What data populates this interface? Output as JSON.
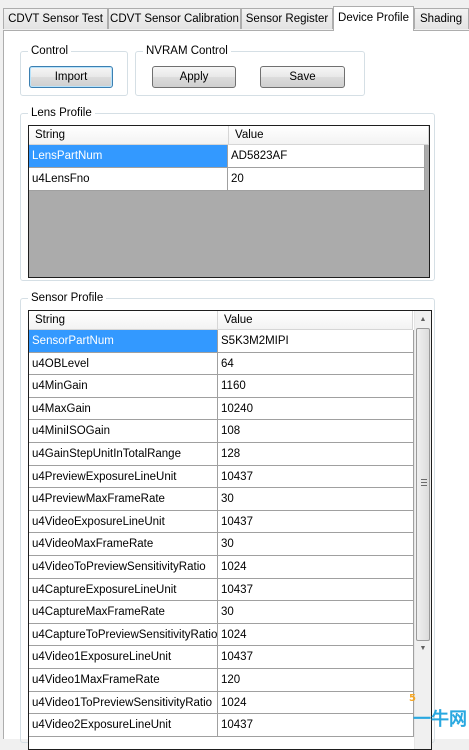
{
  "tabs": [
    {
      "label": "CDVT Sensor Test",
      "active": false
    },
    {
      "label": "CDVT Sensor Calibration",
      "active": false
    },
    {
      "label": "Sensor Register",
      "active": false
    },
    {
      "label": "Device Profile",
      "active": true
    },
    {
      "label": "Shading",
      "active": false
    }
  ],
  "control": {
    "label": "Control",
    "import_label": "Import"
  },
  "nvram": {
    "label": "NVRAM Control",
    "apply_label": "Apply",
    "save_label": "Save"
  },
  "lens_profile": {
    "label": "Lens Profile",
    "headers": [
      "String",
      "Value"
    ],
    "rows": [
      {
        "string": "LensPartNum",
        "value": "AD5823AF",
        "selected": true
      },
      {
        "string": "u4LensFno",
        "value": "20",
        "selected": false
      }
    ]
  },
  "sensor_profile": {
    "label": "Sensor Profile",
    "headers": [
      "String",
      "Value"
    ],
    "rows": [
      {
        "string": "SensorPartNum",
        "value": "S5K3M2MIPI",
        "selected": true
      },
      {
        "string": "u4OBLevel",
        "value": "64"
      },
      {
        "string": "u4MinGain",
        "value": "1160"
      },
      {
        "string": "u4MaxGain",
        "value": "10240"
      },
      {
        "string": "u4MiniISOGain",
        "value": "108"
      },
      {
        "string": "u4GainStepUnitInTotalRange",
        "value": "128"
      },
      {
        "string": "u4PreviewExposureLineUnit",
        "value": "10437"
      },
      {
        "string": "u4PreviewMaxFrameRate",
        "value": "30"
      },
      {
        "string": "u4VideoExposureLineUnit",
        "value": "10437"
      },
      {
        "string": "u4VideoMaxFrameRate",
        "value": "30"
      },
      {
        "string": "u4VideoToPreviewSensitivityRatio",
        "value": "1024"
      },
      {
        "string": "u4CaptureExposureLineUnit",
        "value": "10437"
      },
      {
        "string": "u4CaptureMaxFrameRate",
        "value": "30"
      },
      {
        "string": "u4CaptureToPreviewSensitivityRatio",
        "value": "1024"
      },
      {
        "string": "u4Video1ExposureLineUnit",
        "value": "10437"
      },
      {
        "string": "u4Video1MaxFrameRate",
        "value": "120"
      },
      {
        "string": "u4Video1ToPreviewSensitivityRatio",
        "value": "1024"
      },
      {
        "string": "u4Video2ExposureLineUnit",
        "value": "10437"
      }
    ],
    "scroll_position": 0.0
  },
  "watermark": {
    "text": "一牛网",
    "mark": "5"
  }
}
